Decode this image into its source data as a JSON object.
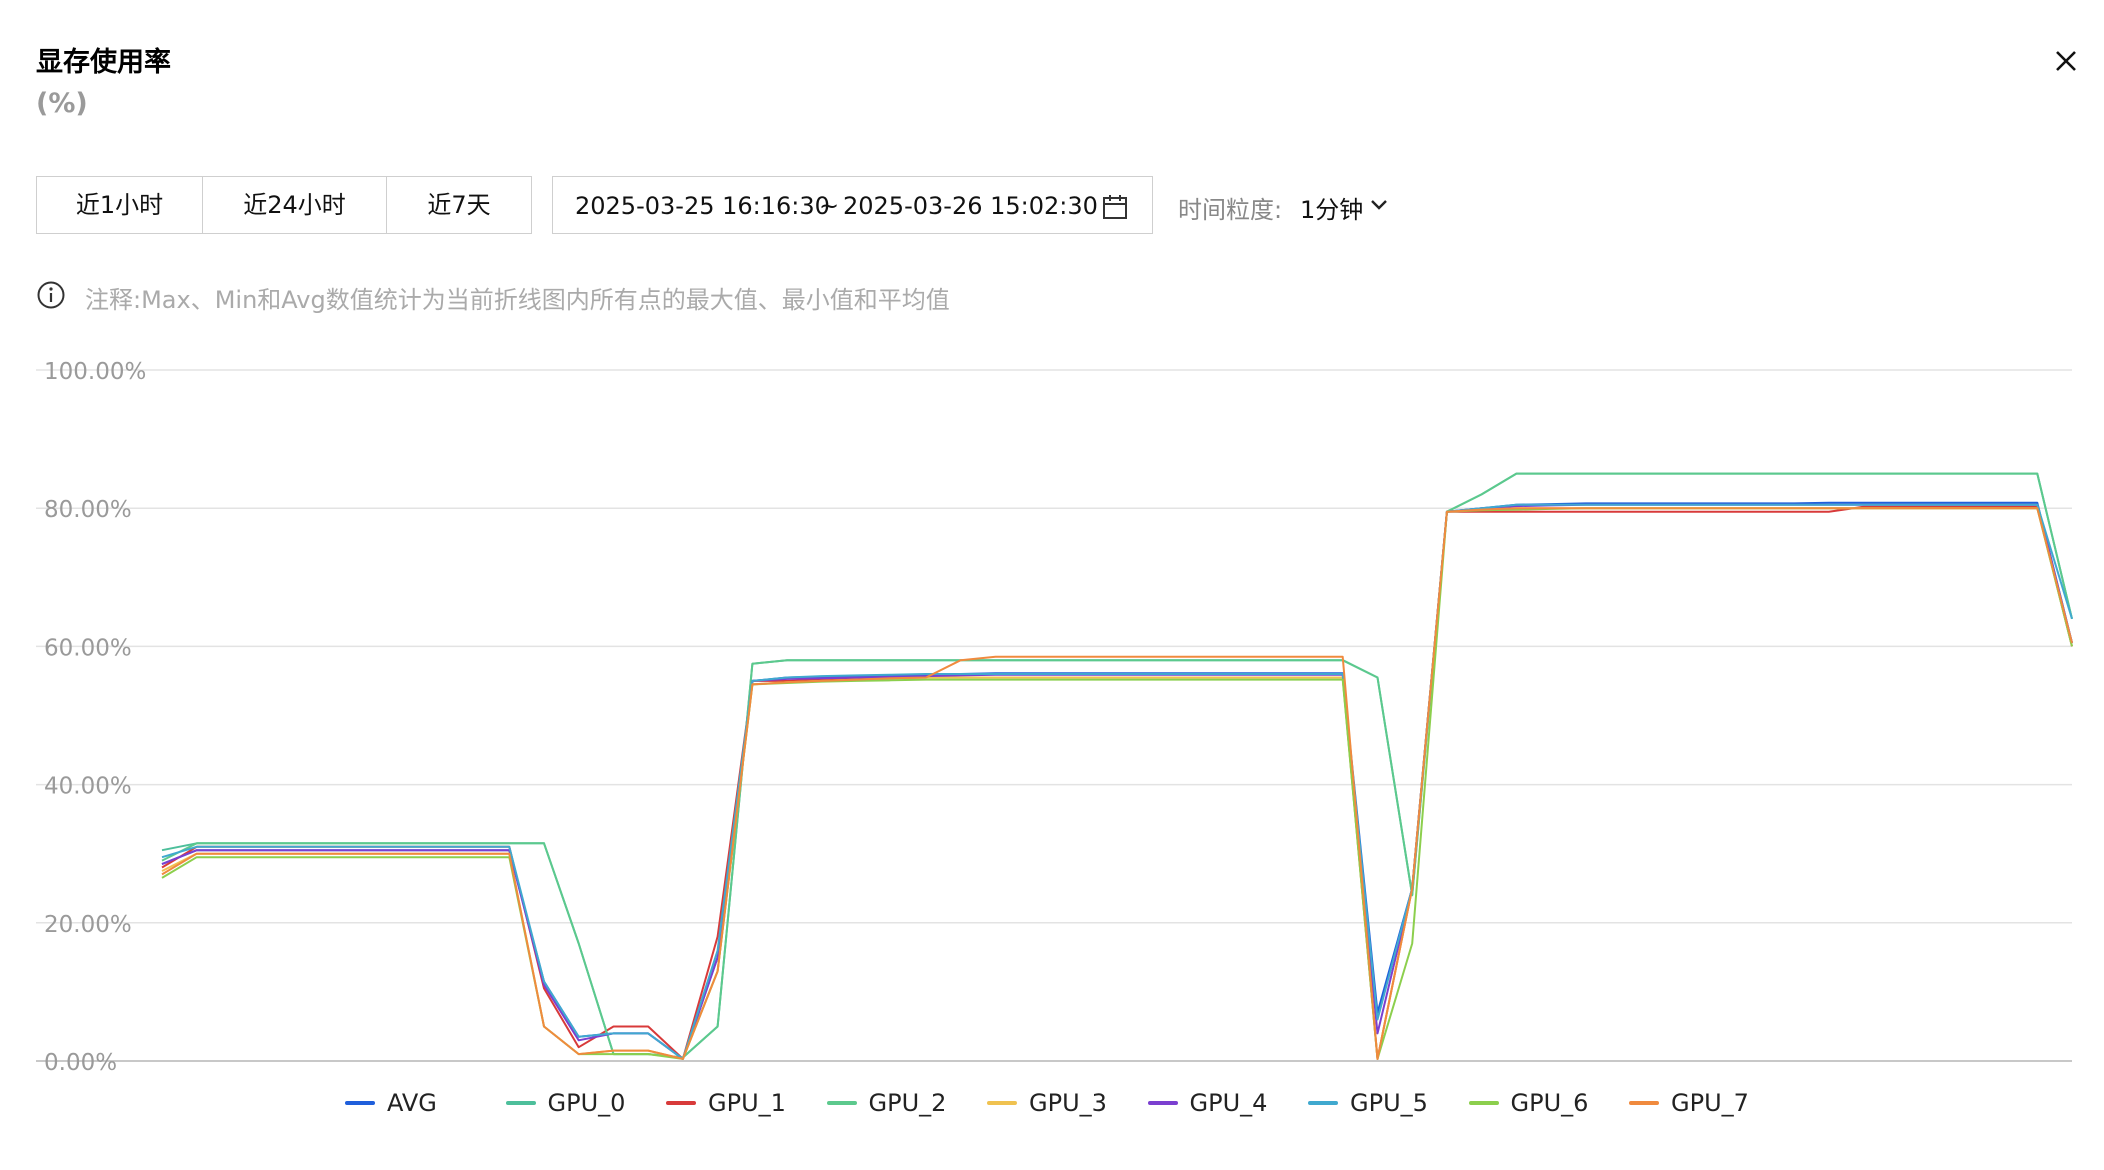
{
  "header": {
    "title": "显存使用率",
    "unit": "(%)",
    "close_icon": "close-icon"
  },
  "toolbar": {
    "quick_ranges": [
      "近1小时",
      "近24小时",
      "近7天"
    ],
    "range_start": "2025-03-25 16:16:30",
    "range_sep": "~",
    "range_end": "2025-03-26 15:02:30",
    "calendar_icon": "calendar-icon",
    "granularity_label": "时间粒度:",
    "granularity_value": "1分钟"
  },
  "note": {
    "icon": "info-icon",
    "text": "注释:Max、Min和Avg数值统计为当前折线图内所有点的最大值、最小值和平均值"
  },
  "chart_data": {
    "type": "line",
    "y_tick_labels": [
      "100.00%",
      "80.00%",
      "60.00%",
      "40.00%",
      "20.00%",
      "0.00%"
    ],
    "ylim": [
      0,
      100
    ],
    "grid": true,
    "legend_position": "bottom",
    "x": [
      0,
      1,
      2,
      3,
      4,
      5,
      6,
      7,
      8,
      9,
      10,
      11,
      12,
      13,
      14,
      15,
      16,
      17,
      18,
      19,
      20,
      21,
      22,
      23,
      24,
      25,
      26,
      27,
      28,
      29,
      30,
      31,
      32,
      33,
      34,
      35,
      36,
      37,
      38,
      39,
      40,
      41,
      42,
      43,
      44,
      45,
      46,
      47,
      48,
      49,
      50,
      51,
      52,
      53,
      54,
      55
    ],
    "series": [
      {
        "name": "AVG",
        "color": "#1f5fdb",
        "values": [
          28.5,
          30.5,
          30.5,
          30.5,
          30.5,
          30.5,
          30.5,
          30.5,
          30.5,
          30.5,
          30.5,
          11.5,
          3.5,
          4,
          4,
          0.3,
          15,
          55,
          55.5,
          55.6,
          55.7,
          55.8,
          55.9,
          56,
          56.1,
          56.1,
          56.1,
          56.1,
          56.1,
          56.1,
          56.1,
          56.1,
          56.1,
          56.1,
          56.1,
          7,
          25,
          79.5,
          80,
          80.5,
          80.6,
          80.7,
          80.7,
          80.7,
          80.7,
          80.7,
          80.7,
          80.7,
          80.8,
          80.8,
          80.8,
          80.8,
          80.8,
          80.8,
          80.8,
          60.5
        ]
      },
      {
        "name": "GPU_0",
        "color": "#4dbf9b",
        "values": [
          30.5,
          31.5,
          31.5,
          31.5,
          31.5,
          31.5,
          31.5,
          31.5,
          31.5,
          31.5,
          31.5,
          31.5,
          17,
          1,
          1,
          0.5,
          5,
          57.5,
          58,
          58,
          58,
          58,
          58,
          58,
          58,
          58,
          58,
          58,
          58,
          58,
          58,
          58,
          58,
          58,
          58,
          55.5,
          24,
          79.5,
          82,
          85,
          85,
          85,
          85,
          85,
          85,
          85,
          85,
          85,
          85,
          85,
          85,
          85,
          85,
          85,
          85,
          64
        ]
      },
      {
        "name": "GPU_1",
        "color": "#d83a3a",
        "values": [
          28,
          31,
          31,
          31,
          31,
          31,
          31,
          31,
          31,
          31,
          31,
          10.5,
          2,
          5,
          5,
          0.3,
          18,
          55,
          55,
          55.2,
          55.3,
          55.4,
          55.5,
          55.5,
          55.5,
          55.5,
          55.5,
          55.5,
          55.5,
          55.5,
          55.5,
          55.5,
          55.5,
          55.5,
          55.5,
          0.3,
          25,
          79.5,
          79.5,
          79.5,
          79.5,
          79.5,
          79.5,
          79.5,
          79.5,
          79.5,
          79.5,
          79.5,
          79.5,
          80.2,
          80.2,
          80.2,
          80.2,
          80.2,
          80.2,
          60
        ]
      },
      {
        "name": "GPU_2",
        "color": "#5cc98d",
        "values": [
          29,
          31.5,
          31.5,
          31.5,
          31.5,
          31.5,
          31.5,
          31.5,
          31.5,
          31.5,
          31.5,
          31.5,
          17,
          1,
          1,
          0.5,
          5,
          57.5,
          58,
          58,
          58,
          58,
          58,
          58,
          58,
          58,
          58,
          58,
          58,
          58,
          58,
          58,
          58,
          58,
          58,
          55.5,
          24,
          79.5,
          82,
          85,
          85,
          85,
          85,
          85,
          85,
          85,
          85,
          85,
          85,
          85,
          85,
          85,
          85,
          85,
          85,
          64
        ]
      },
      {
        "name": "GPU_3",
        "color": "#f0c250",
        "values": [
          27.5,
          30,
          30,
          30,
          30,
          30,
          30,
          30,
          30,
          30,
          30,
          5,
          1,
          1.5,
          1.5,
          0.3,
          13,
          54.5,
          54.8,
          55,
          55.2,
          55.4,
          55.5,
          55.5,
          55.5,
          55.5,
          55.5,
          55.5,
          55.5,
          55.5,
          55.5,
          55.5,
          55.5,
          55.5,
          55.5,
          0.3,
          25,
          79.5,
          79.8,
          80,
          80,
          80,
          80,
          80,
          80,
          80,
          80,
          80,
          80,
          80,
          80,
          80,
          80,
          80,
          80,
          60.5
        ]
      },
      {
        "name": "GPU_4",
        "color": "#7b3fd0",
        "values": [
          28.5,
          30.5,
          30.5,
          30.5,
          30.5,
          30.5,
          30.5,
          30.5,
          30.5,
          30.5,
          30.5,
          11,
          3,
          4,
          4,
          0.3,
          15,
          55,
          55.3,
          55.4,
          55.5,
          55.6,
          55.7,
          55.8,
          55.9,
          55.9,
          55.9,
          55.9,
          55.9,
          55.9,
          55.9,
          55.9,
          55.9,
          55.9,
          55.9,
          4,
          25,
          79.5,
          80,
          80.3,
          80.4,
          80.5,
          80.5,
          80.5,
          80.5,
          80.5,
          80.5,
          80.5,
          80.5,
          80.5,
          80.5,
          80.5,
          80.5,
          80.5,
          80.5,
          60.5
        ]
      },
      {
        "name": "GPU_5",
        "color": "#40a9cf",
        "values": [
          29.5,
          31,
          31,
          31,
          31,
          31,
          31,
          31,
          31,
          31,
          31,
          11.5,
          3.5,
          4,
          4,
          0.3,
          16,
          55,
          55.5,
          55.7,
          55.8,
          55.9,
          56,
          56,
          56,
          56,
          56,
          56,
          56,
          56,
          56,
          56,
          56,
          56,
          56,
          6,
          25,
          79.5,
          80,
          80.5,
          80.5,
          80.5,
          80.5,
          80.5,
          80.5,
          80.5,
          80.5,
          80.5,
          80.5,
          80.5,
          80.5,
          80.5,
          80.5,
          80.5,
          80.5,
          64
        ]
      },
      {
        "name": "GPU_6",
        "color": "#8ccf4d",
        "values": [
          26.5,
          29.5,
          29.5,
          29.5,
          29.5,
          29.5,
          29.5,
          29.5,
          29.5,
          29.5,
          29.5,
          5,
          1,
          1,
          1,
          0.3,
          13,
          54.5,
          54.7,
          54.9,
          55,
          55.1,
          55.2,
          55.2,
          55.2,
          55.2,
          55.2,
          55.2,
          55.2,
          55.2,
          55.2,
          55.2,
          55.2,
          55.2,
          55.2,
          0.3,
          17,
          79.5,
          79.7,
          79.8,
          79.9,
          80,
          80,
          80,
          80,
          80,
          80,
          80,
          80,
          80,
          80,
          80,
          80,
          80,
          80,
          60
        ]
      },
      {
        "name": "GPU_7",
        "color": "#f08a3e",
        "values": [
          27,
          30,
          30,
          30,
          30,
          30,
          30,
          30,
          30,
          30,
          30,
          5,
          1,
          1.5,
          1.5,
          0.3,
          13,
          54.5,
          54.8,
          55,
          55.2,
          55.4,
          55.5,
          58,
          58.5,
          58.5,
          58.5,
          58.5,
          58.5,
          58.5,
          58.5,
          58.5,
          58.5,
          58.5,
          58.5,
          0.3,
          25,
          79.5,
          79.8,
          80,
          80,
          80,
          80,
          80,
          80,
          80,
          80,
          80,
          80,
          80,
          80,
          80,
          80,
          80,
          80,
          60.5
        ]
      }
    ]
  }
}
